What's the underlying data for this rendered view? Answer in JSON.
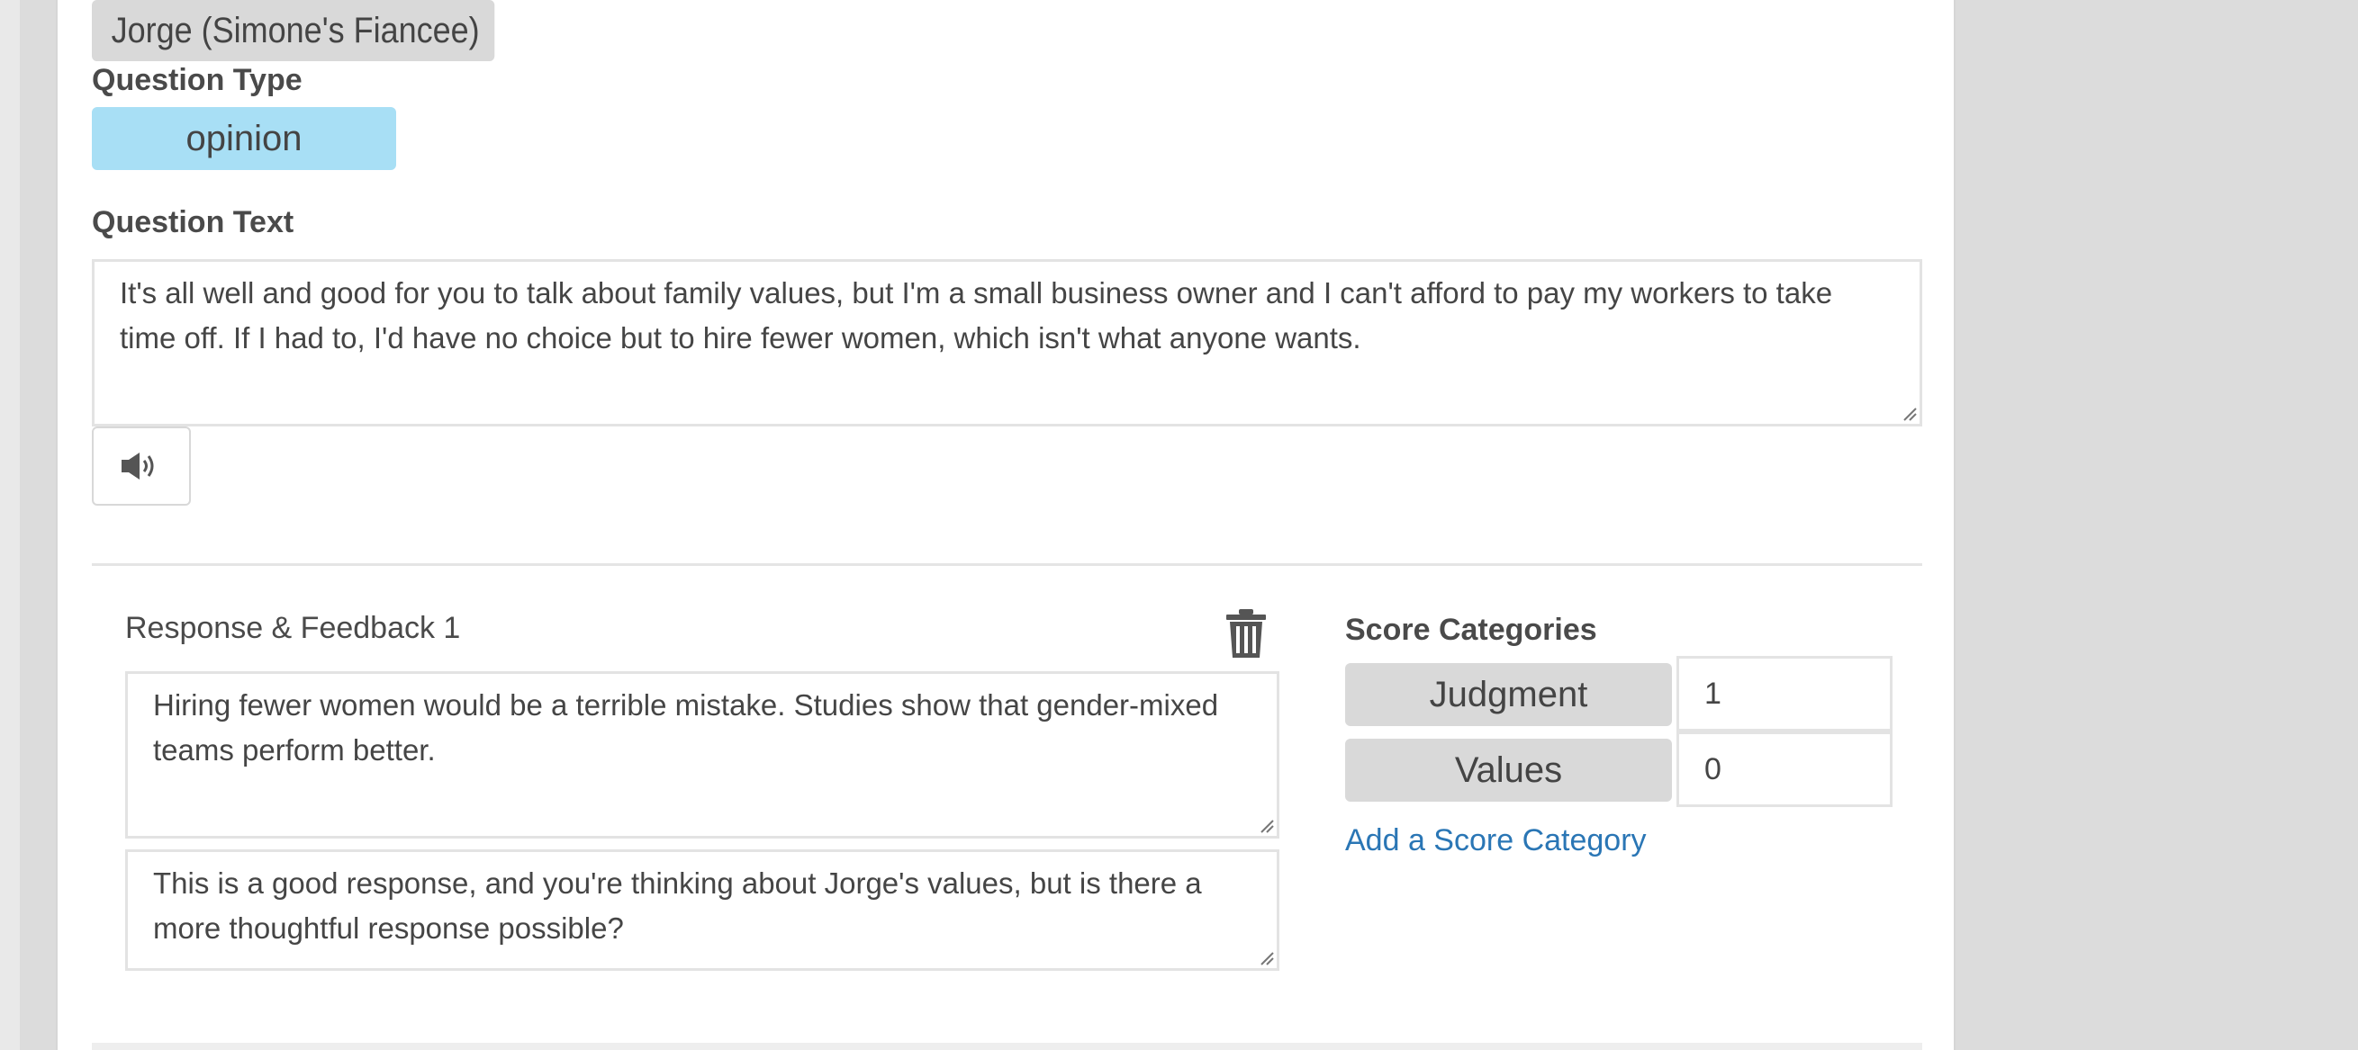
{
  "character": {
    "name": "Jorge (Simone's Fiancee)"
  },
  "question_type": {
    "label": "Question Type",
    "value": "opinion",
    "color": "#a8dff5"
  },
  "question_text": {
    "label": "Question Text",
    "value": "It's all well and good for you to talk about family values, but I'm a small business owner and I can't afford to pay my workers to take time off. If I had to, I'd have no choice but to hire fewer women, which isn't what anyone wants."
  },
  "audio_button": {
    "icon": "speaker-icon"
  },
  "response": {
    "label": "Response & Feedback 1",
    "response_text": "Hiring fewer women would be a terrible mistake. Studies show that gender-mixed teams perform better.",
    "feedback_text": "This is a good response, and you're thinking about Jorge's values, but is there a more thoughtful response possible?",
    "delete_icon": "trash-icon"
  },
  "score_categories": {
    "label": "Score Categories",
    "items": [
      {
        "name": "Judgment",
        "value": "1"
      },
      {
        "name": "Values",
        "value": "0"
      }
    ],
    "add_link": "Add a Score Category",
    "link_color": "#2a76b5"
  }
}
